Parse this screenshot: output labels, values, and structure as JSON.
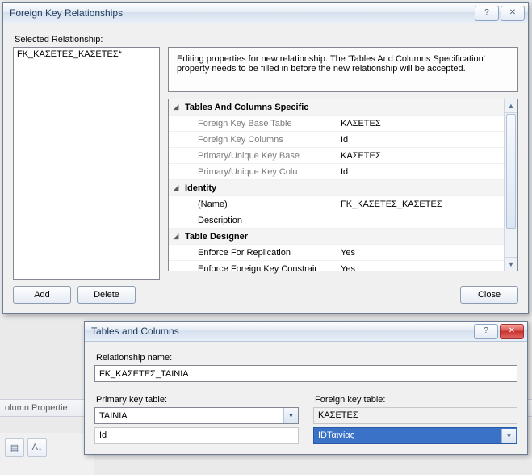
{
  "dialog1": {
    "title": "Foreign Key Relationships",
    "selected_label": "Selected Relationship:",
    "list_item": "FK_ΚΑΣΕΤΕΣ_ΚΑΣΕΤΕΣ*",
    "desc": "Editing properties for new relationship.  The 'Tables And Columns Specification' property needs to be filled in before the new relationship will be accepted.",
    "props": {
      "cat1": "Tables And Columns Specific",
      "fk_base_table_k": "Foreign Key Base Table",
      "fk_base_table_v": "ΚΑΣΕΤΕΣ",
      "fk_cols_k": "Foreign Key Columns",
      "fk_cols_v": "Id",
      "pk_base_k": "Primary/Unique Key Base",
      "pk_base_v": "ΚΑΣΕΤΕΣ",
      "pk_cols_k": "Primary/Unique Key Colu",
      "pk_cols_v": "Id",
      "cat2": "Identity",
      "name_k": "(Name)",
      "name_v": "FK_ΚΑΣΕΤΕΣ_ΚΑΣΕΤΕΣ",
      "desc_k": "Description",
      "desc_v": "",
      "cat3": "Table Designer",
      "enf_rep_k": "Enforce For Replication",
      "enf_rep_v": "Yes",
      "enf_fk_k": "Enforce Foreign Key Constrair",
      "enf_fk_v": "Yes"
    },
    "buttons": {
      "add": "Add",
      "delete": "Delete",
      "close": "Close"
    }
  },
  "dialog2": {
    "title": "Tables and Columns",
    "rel_name_label": "Relationship name:",
    "rel_name_value": "FK_ΚΑΣΕΤΕΣ_ΤΑΙΝΙΑ",
    "pk_table_label": "Primary key table:",
    "fk_table_label": "Foreign key table:",
    "pk_table_value": "ΤΑΙΝΙΑ",
    "fk_table_value": "ΚΑΣΕΤΕΣ",
    "pk_col": "Id",
    "fk_col": "IDΤαινίας"
  },
  "bg": {
    "panel": "olumn Propertie"
  }
}
